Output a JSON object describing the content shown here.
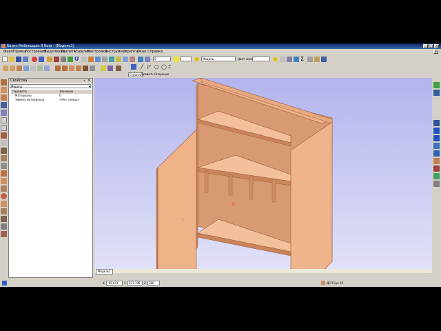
{
  "window": {
    "title": "Базис-Мебельщик 9 Beta - [Модель1]"
  },
  "menu": [
    "Файл",
    "Правка",
    "Построение",
    "Выделение",
    "Удалить",
    "Изделие",
    "Настройка",
    "Инструмент",
    "Скрипты",
    "Окно",
    "Справка"
  ],
  "help_search": {
    "value": "По умолчанию"
  },
  "toolbar": {
    "numeric_field": "0",
    "layer_name": "Модель",
    "line_color_label": "Цвет линии"
  },
  "tabs": [
    "Строить",
    "Править",
    "Операции"
  ],
  "properties_panel": {
    "title": "Свойства",
    "object": "Модель",
    "columns": [
      "Параметр",
      "Значение"
    ],
    "rows": [
      {
        "param": "Материалы",
        "value": "0"
      },
      {
        "param": "Замена материалов",
        "value": "<Нет смены>"
      }
    ]
  },
  "viewport": {
    "tab_label": "Модель1"
  },
  "status": {
    "x_label": "X",
    "x_value": "-95,641",
    "y_label": "Y",
    "y_value": "221,196",
    "z_label": "Z",
    "z_value": "200",
    "material": "ДСП Бук 16"
  },
  "colors": {
    "wood_face": "#f0b890",
    "wood_side": "#d0906a",
    "wood_edge": "#9a5a3a",
    "viewport_top": "#b3b4ec",
    "viewport_bottom": "#e2e2f8",
    "titlebar": "#0a246a"
  }
}
